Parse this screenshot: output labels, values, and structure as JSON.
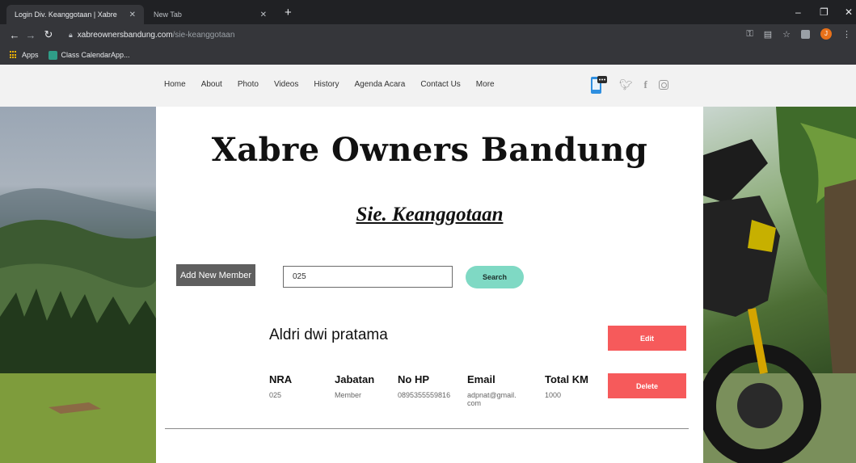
{
  "browser": {
    "tabs": [
      {
        "title": "Login Div. Keanggotaan | Xabre",
        "active": true
      },
      {
        "title": "New Tab",
        "active": false
      }
    ],
    "url_host": "xabreownersbandung.com",
    "url_path": "/sie-keanggotaan",
    "bookmarks": [
      "Apps",
      "Class CalendarApp..."
    ],
    "avatar_letter": "J"
  },
  "nav": {
    "items": [
      "Home",
      "About",
      "Photo",
      "Videos",
      "History",
      "Agenda Acara",
      "Contact Us",
      "More"
    ]
  },
  "page": {
    "title": "Xabre Owners Bandung",
    "section_title": "Sie. Keanggotaan",
    "add_member_label": "Add New Member",
    "search_value": "025",
    "search_label": "Search"
  },
  "member": {
    "name": "Aldri dwi pratama",
    "edit_label": "Edit",
    "delete_label": "Delete",
    "fields": {
      "nra": {
        "label": "NRA",
        "value": "025"
      },
      "jabatan": {
        "label": "Jabatan",
        "value": "Member"
      },
      "no_hp": {
        "label": "No HP",
        "value": "0895355559816"
      },
      "email": {
        "label": "Email",
        "value": "adpnat@gmail.com"
      },
      "total_km": {
        "label": "Total KM",
        "value": "1000"
      }
    }
  },
  "colors": {
    "accent_red": "#f65a5b",
    "search_teal": "#7fd9c4",
    "add_button_gray": "#5f5f5f"
  }
}
